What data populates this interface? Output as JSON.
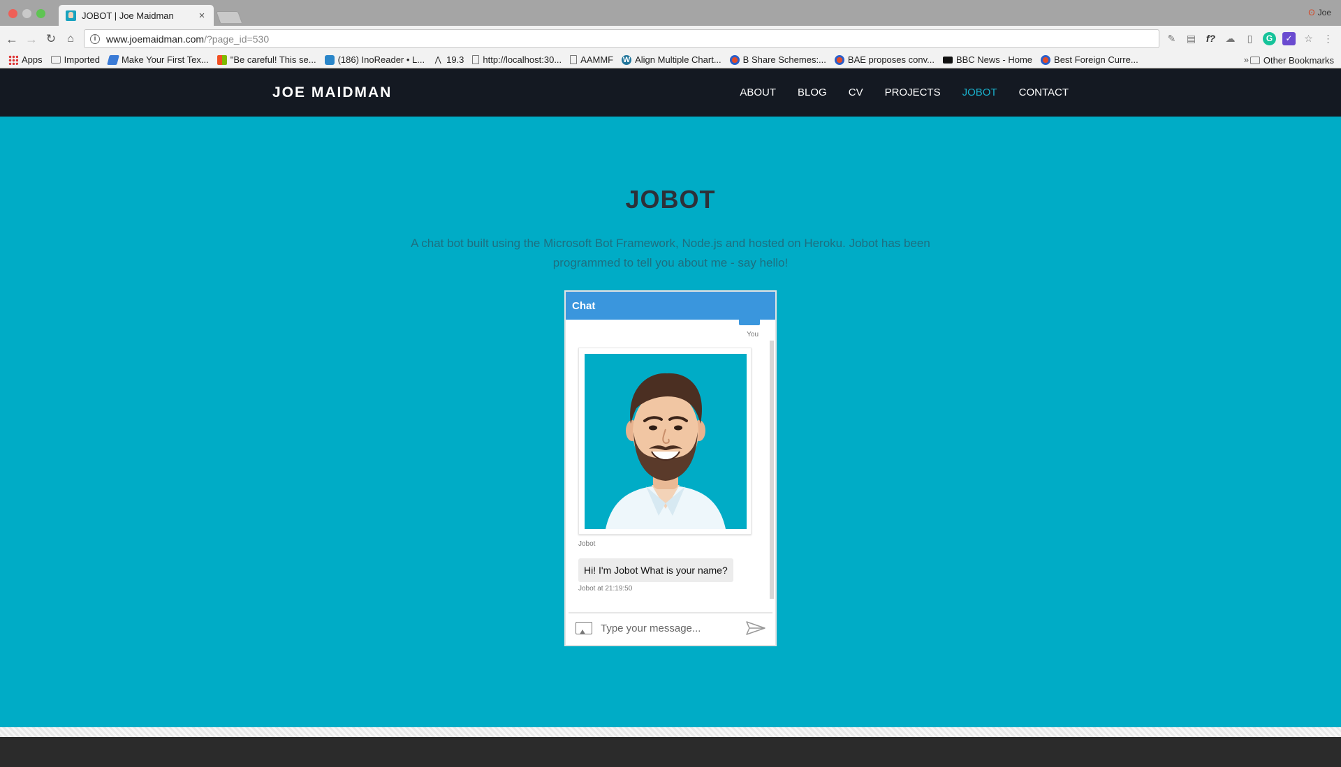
{
  "browser": {
    "tab_title": "JOBOT | Joe Maidman",
    "tab_close": "×",
    "profile_name": "Joe",
    "url_host": "www.joemaidman.com",
    "url_path": "/?page_id=530",
    "bookmarks": [
      {
        "label": "Apps",
        "icon": "apps-icon"
      },
      {
        "label": "Imported",
        "icon": "folder-icon"
      },
      {
        "label": "Make Your First Tex...",
        "icon": "bookmark-icon"
      },
      {
        "label": "\"Be careful! This se...",
        "icon": "microsoft-icon"
      },
      {
        "label": "(186) InoReader • L...",
        "icon": "inoreader-icon"
      },
      {
        "label": "19.3",
        "icon": "bookmark-icon"
      },
      {
        "label": "http://localhost:30...",
        "icon": "page-icon"
      },
      {
        "label": "AAMMF",
        "icon": "page-icon"
      },
      {
        "label": "Align Multiple Chart...",
        "icon": "wordpress-icon"
      },
      {
        "label": "B Share Schemes:...",
        "icon": "globe-icon"
      },
      {
        "label": "BAE proposes conv...",
        "icon": "globe-icon"
      },
      {
        "label": "BBC News - Home",
        "icon": "bbc-icon"
      },
      {
        "label": "Best Foreign Curre...",
        "icon": "globe-icon"
      }
    ],
    "bookmarks_more": "»",
    "other_bookmarks": "Other Bookmarks"
  },
  "site": {
    "logo": "JOE MAIDMAN",
    "menu": [
      {
        "label": "ABOUT",
        "active": false
      },
      {
        "label": "BLOG",
        "active": false
      },
      {
        "label": "CV",
        "active": false
      },
      {
        "label": "PROJECTS",
        "active": false
      },
      {
        "label": "JOBOT",
        "active": true
      },
      {
        "label": "CONTACT",
        "active": false
      }
    ],
    "accent_color": "#00acc6",
    "header_color": "#141922"
  },
  "main": {
    "title": "JOBOT",
    "intro": "A chat bot built using the Microsoft Bot Framework, Node.js and hosted on Heroku. Jobot has been programmed to tell you about me - say hello!"
  },
  "chat": {
    "header": "Chat",
    "user_label": "You",
    "bot_name": "Jobot",
    "bot_message": "Hi! I'm Jobot What is your name?",
    "bot_timestamp": "Jobot at 21:19:50",
    "input_placeholder": "Type your message...",
    "header_color": "#3a96dd"
  }
}
